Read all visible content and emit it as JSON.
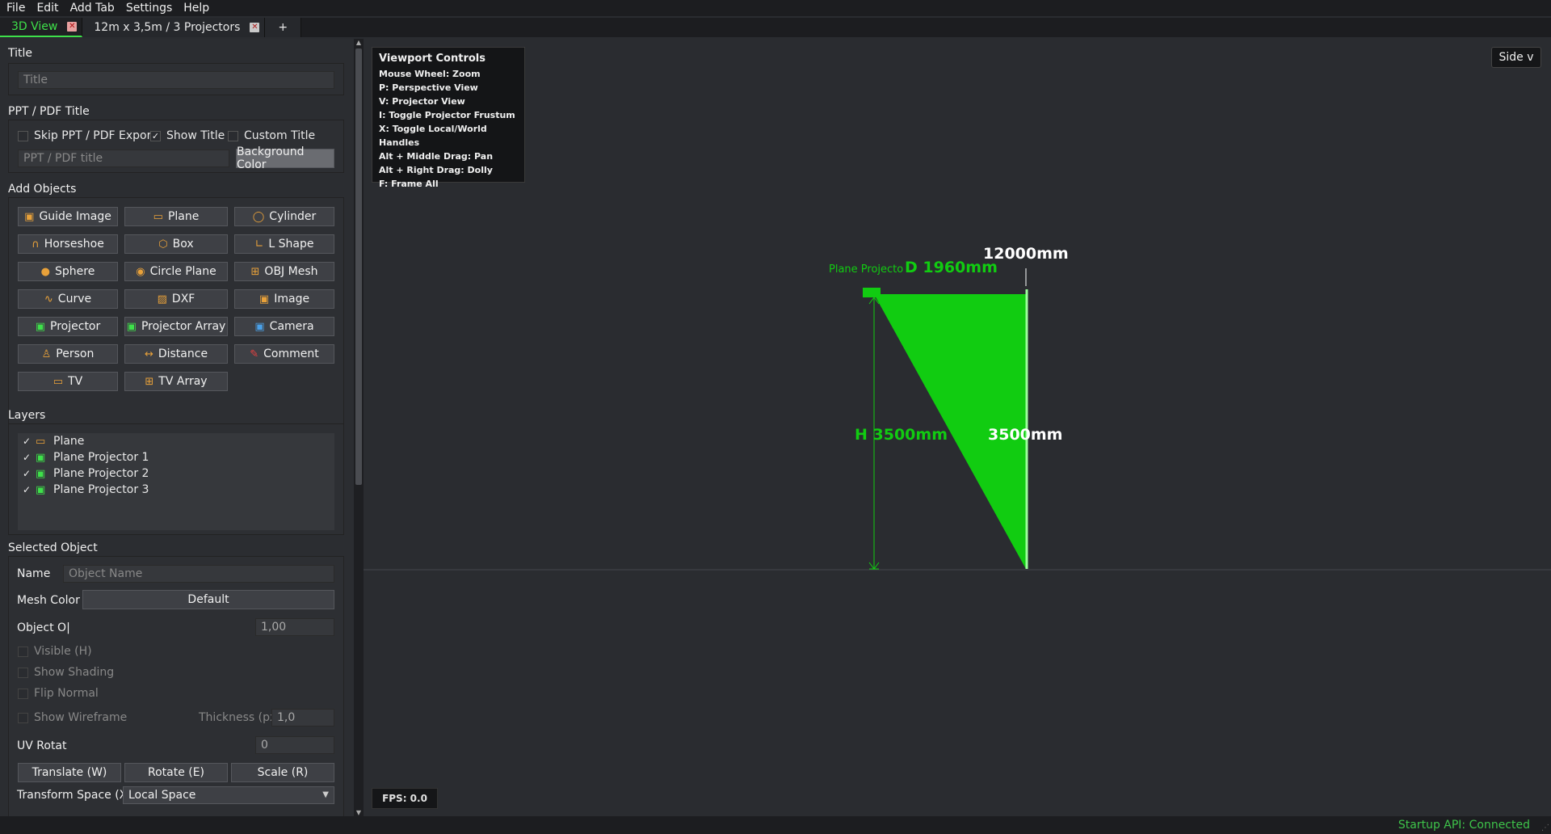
{
  "menu": [
    "File",
    "Edit",
    "Add Tab",
    "Settings",
    "Help"
  ],
  "tabs": [
    {
      "label": "3D View",
      "active": true
    },
    {
      "label": "12m x 3,5m / 3 Projectors",
      "active": false
    }
  ],
  "tab_add": "+",
  "title_section": {
    "heading": "Title",
    "placeholder": "Title"
  },
  "pdf_section": {
    "heading": "PPT / PDF Title",
    "skip_label": "Skip PPT / PDF Export",
    "show_title_label": "Show Title",
    "show_title_checked": true,
    "custom_title_label": "Custom Title",
    "placeholder": "PPT / PDF title",
    "bg_color_button": "Background Color"
  },
  "add_objects": {
    "heading": "Add Objects",
    "buttons": [
      {
        "label": "Guide Image",
        "icon": "image-icon"
      },
      {
        "label": "Plane",
        "icon": "plane-icon"
      },
      {
        "label": "Cylinder",
        "icon": "cylinder-icon"
      },
      {
        "label": "Horseshoe",
        "icon": "horseshoe-icon"
      },
      {
        "label": "Box",
        "icon": "box-icon"
      },
      {
        "label": "L Shape",
        "icon": "l-shape-icon"
      },
      {
        "label": "Sphere",
        "icon": "sphere-icon"
      },
      {
        "label": "Circle Plane",
        "icon": "circle-plane-icon"
      },
      {
        "label": "OBJ Mesh",
        "icon": "mesh-icon"
      },
      {
        "label": "Curve",
        "icon": "curve-icon"
      },
      {
        "label": "DXF",
        "icon": "dxf-icon"
      },
      {
        "label": "Image",
        "icon": "image-icon"
      },
      {
        "label": "Projector",
        "icon": "projector-icon"
      },
      {
        "label": "Projector Array",
        "icon": "projector-array-icon"
      },
      {
        "label": "Camera",
        "icon": "camera-icon"
      },
      {
        "label": "Person",
        "icon": "person-icon"
      },
      {
        "label": "Distance",
        "icon": "distance-icon"
      },
      {
        "label": "Comment",
        "icon": "comment-icon"
      },
      {
        "label": "TV",
        "icon": "tv-icon"
      },
      {
        "label": "TV Array",
        "icon": "tv-array-icon"
      }
    ]
  },
  "layers": {
    "heading": "Layers",
    "items": [
      {
        "label": "Plane",
        "icon": "plane-icon"
      },
      {
        "label": "Plane Projector 1",
        "icon": "projector-icon"
      },
      {
        "label": "Plane Projector 2",
        "icon": "projector-icon"
      },
      {
        "label": "Plane Projector 3",
        "icon": "projector-icon"
      }
    ]
  },
  "selected": {
    "heading": "Selected Object",
    "name_label": "Name",
    "name_placeholder": "Object Name",
    "mesh_color_label": "Mesh Color",
    "mesh_color_value": "Default",
    "opacity_label": "Object O|",
    "opacity_value": "1,00",
    "visible_label": "Visible (H)",
    "shading_label": "Show Shading",
    "flip_label": "Flip Normal",
    "wireframe_label": "Show Wireframe",
    "thickness_label": "Thickness (px)",
    "thickness_value": "1,0",
    "uv_label": "UV Rotat",
    "uv_value": "0",
    "translate_button": "Translate (W)",
    "rotate_button": "Rotate (E)",
    "scale_button": "Scale (R)",
    "transform_space_label": "Transform Space (X)",
    "transform_space_value": "Local Space"
  },
  "viewport": {
    "controls_title": "Viewport Controls",
    "controls": [
      "Mouse Wheel: Zoom",
      "P: Perspective View",
      "V: Projector View",
      "I: Toggle Projector Frustum",
      "X: Toggle Local/World Handles",
      "Alt + Middle Drag: Pan",
      "Alt + Right Drag: Dolly",
      "F: Frame All"
    ],
    "view_button": "Side v",
    "fps": "FPS: 0.0",
    "labels": {
      "projector_name": "Plane Projecto",
      "distance": "D 1960mm",
      "width": "12000mm",
      "height_label": "H 3500mm",
      "screen_height": "3500mm"
    },
    "accent": "#11cc11"
  },
  "status": "Startup API: Connected"
}
